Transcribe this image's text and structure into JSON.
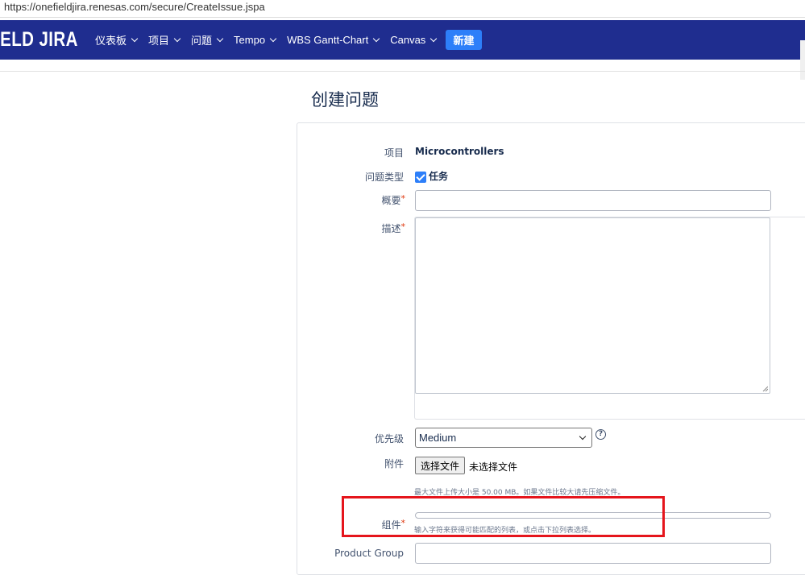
{
  "browser": {
    "url": "https://onefieldjira.renesas.com/secure/CreateIssue.jspa"
  },
  "nav": {
    "logo": "IELD JIRA",
    "items": [
      {
        "label": "仪表板"
      },
      {
        "label": "项目"
      },
      {
        "label": "问题"
      },
      {
        "label": "Tempo"
      },
      {
        "label": "WBS Gantt-Chart"
      },
      {
        "label": "Canvas"
      }
    ],
    "create_label": "新建",
    "accent": "#1f2d8f",
    "button_color": "#2d7ff9"
  },
  "page": {
    "title": "创建问题"
  },
  "form": {
    "project_label": "项目",
    "project_value": "Microcontrollers",
    "issuetype_label": "问题类型",
    "issuetype_value": "任务",
    "summary_label": "概要",
    "summary_value": "",
    "description_label": "描述",
    "description_value": "",
    "priority_label": "优先级",
    "priority_value": "Medium",
    "help_glyph": "?",
    "attachment_label": "附件",
    "file_button_label": "选择文件",
    "file_status": "未选择文件",
    "attachment_hint": "最大文件上传大小是 50.00 MB。如果文件比较大请先压缩文件。",
    "component_label": "组件",
    "component_value": "",
    "component_hint": "输入字符来获得可能匹配的列表，或点击下拉列表选择。",
    "product_group_label": "Product Group",
    "required_mark": "*"
  }
}
